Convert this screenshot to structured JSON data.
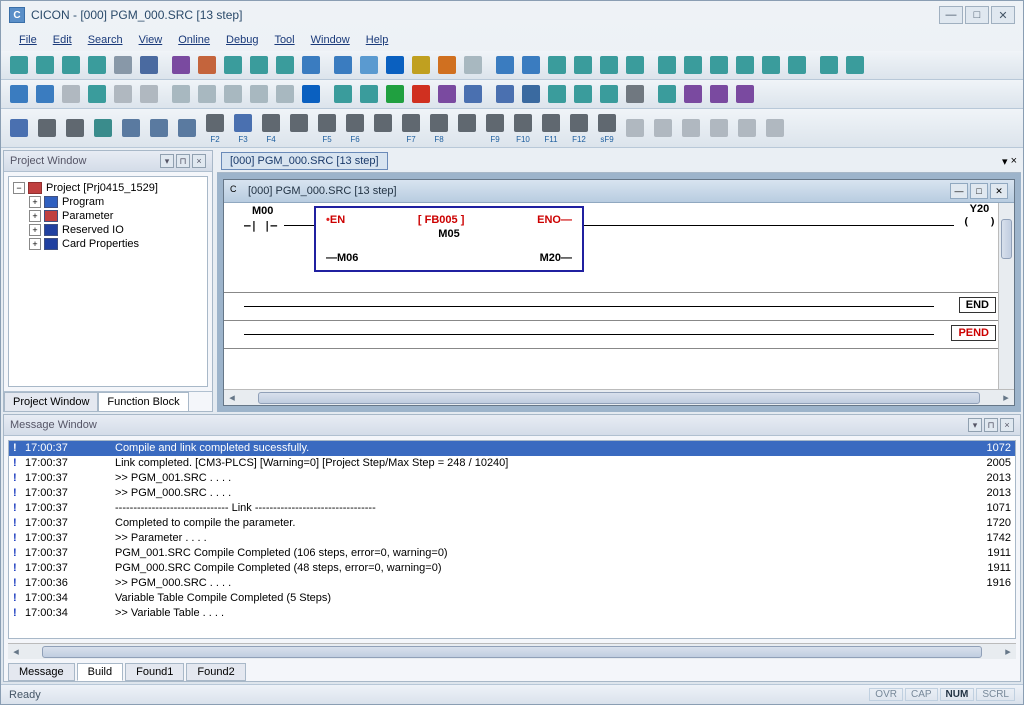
{
  "app": {
    "title": "CICON - [000] PGM_000.SRC [13 step]",
    "icon_letter": "C"
  },
  "menu": [
    "File",
    "Edit",
    "Search",
    "View",
    "Online",
    "Debug",
    "Tool",
    "Window",
    "Help"
  ],
  "project_window": {
    "title": "Project Window",
    "root": "Project [Prj0415_1529]",
    "children": [
      "Program",
      "Parameter",
      "Reserved IO",
      "Card Properties"
    ],
    "tabs": [
      "Project Window",
      "Function Block"
    ],
    "active_tab": 1
  },
  "doc_tab": "[000] PGM_000.SRC [13 step]",
  "subwindow_title": "[000] PGM_000.SRC [13 step]",
  "ladder": {
    "contact": "M00",
    "fb": {
      "title": "[ FB005 ]",
      "en": "EN",
      "eno": "ENO",
      "mid": "M05",
      "left2": "M06",
      "right2": "M20"
    },
    "coil": "Y20",
    "end": "END",
    "pend": "PEND"
  },
  "message_window": {
    "title": "Message Window",
    "rows": [
      {
        "t": "17:00:37",
        "m": "Compile and link completed sucessfully.",
        "c": "1072",
        "sel": true
      },
      {
        "t": "17:00:37",
        "m": "Link completed. [CM3-PLCS] [Warning=0] [Project Step/Max Step = 248 / 10240]",
        "c": "2005"
      },
      {
        "t": "17:00:37",
        "m": ">> PGM_001.SRC . . . .",
        "c": "2013"
      },
      {
        "t": "17:00:37",
        "m": ">> PGM_000.SRC . . . .",
        "c": "2013"
      },
      {
        "t": "17:00:37",
        "m": "------------------------------- Link  ---------------------------------",
        "c": "1071"
      },
      {
        "t": "17:00:37",
        "m": "Completed to compile the parameter.",
        "c": "1720"
      },
      {
        "t": "17:00:37",
        "m": ">> Parameter . . . .",
        "c": "1742"
      },
      {
        "t": "17:00:37",
        "m": "PGM_001.SRC Compile Completed (106 steps, error=0, warning=0)",
        "c": "1911"
      },
      {
        "t": "17:00:37",
        "m": "PGM_000.SRC Compile Completed (48 steps, error=0, warning=0)",
        "c": "1911"
      },
      {
        "t": "17:00:36",
        "m": ">> PGM_000.SRC . . . .",
        "c": "1916"
      },
      {
        "t": "17:00:34",
        "m": "Variable Table Compile Completed (5 Steps)",
        "c": ""
      },
      {
        "t": "17:00:34",
        "m": ">> Variable Table . . . .",
        "c": ""
      }
    ],
    "tabs": [
      "Message",
      "Build",
      "Found1",
      "Found2"
    ],
    "active_tab": 1
  },
  "status": {
    "text": "Ready",
    "indicators": [
      {
        "l": "OVR",
        "on": false
      },
      {
        "l": "CAP",
        "on": false
      },
      {
        "l": "NUM",
        "on": true
      },
      {
        "l": "SCRL",
        "on": false
      }
    ]
  },
  "toolbar_colors": [
    "#3a9c9c",
    "#3a9c9c",
    "#3a9c9c",
    "#3a9c9c",
    "#8898a8",
    "#4a6aa0",
    "#7a4aa0",
    "#c4643c",
    "#3a9c9c",
    "#3a9c9c",
    "#3a9c9c",
    "#3a7cc0",
    "#3a7cc0",
    "#5a9ad0",
    "#0a60c0",
    "#c0a020",
    "#d07020",
    "#a8b8c0",
    "#3a7cc0",
    "#3a7cc0",
    "#3a9c9c",
    "#3a9c9c",
    "#3a9c9c",
    "#3a9c9c",
    "#3a9c9c",
    "#3a9c9c",
    "#3a9c9c",
    "#3a9c9c",
    "#3a9c9c",
    "#3a9c9c",
    "#3a9c9c",
    "#3a9c9c"
  ],
  "toolbar_row2": [
    "#3a7cc0",
    "#3a7cc0",
    "#b0b8c0",
    "#3a9c9c",
    "#b0b8c0",
    "#b0b8c0",
    "#a8b8c0",
    "#a8b8c0",
    "#a8b8c0",
    "#a8b8c0",
    "#a8b8c0",
    "#0a60c0",
    "#3a9c9c",
    "#3a9c9c",
    "#20a040",
    "#d03020",
    "#7a4aa0",
    "#4a70b0",
    "#4a70b0",
    "#3a6aa0",
    "#3a9c9c",
    "#3a9c9c",
    "#3a9c9c",
    "#707880",
    "#3a9c9c",
    "#7a4aa0",
    "#7a4aa0",
    "#7a4aa0"
  ],
  "toolbar_row3": [
    "#4a70b0",
    "#606870",
    "#606870",
    "#3a8c8c",
    "#5a7aa0",
    "#5a7aa0",
    "#5a7aa0",
    "#606870",
    "#4a70b0",
    "#606870",
    "#606870",
    "#606870",
    "#606870",
    "#606870",
    "#606870",
    "#606870",
    "#606870",
    "#606870",
    "#606870",
    "#606870",
    "#606870",
    "#606870",
    "#b0b8c0",
    "#b0b8c0",
    "#b0b8c0",
    "#b0b8c0",
    "#b0b8c0",
    "#b0b8c0"
  ],
  "fkeys": [
    "F2",
    "F3",
    "F4",
    "",
    "F5",
    "F6",
    "",
    "F7",
    "F8",
    "",
    "F9",
    "F10",
    "F11",
    "F12",
    "sF9"
  ]
}
